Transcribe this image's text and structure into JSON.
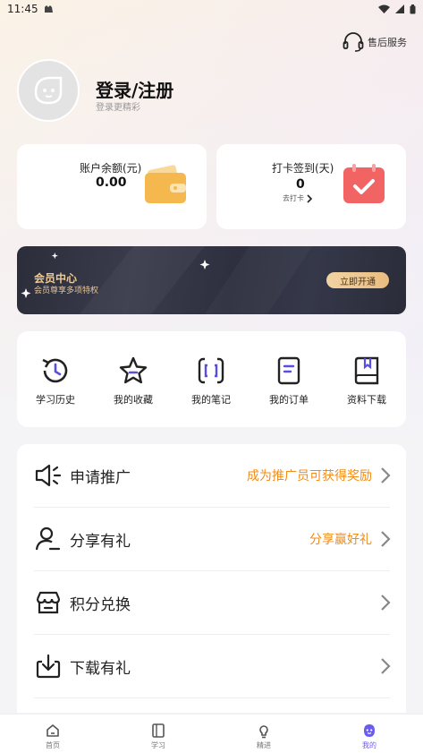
{
  "status_bar": {
    "time": "11:45"
  },
  "header": {
    "service_label": "售后服务"
  },
  "profile": {
    "title": "登录/注册",
    "subtitle": "登录更精彩"
  },
  "stats": {
    "balance": {
      "label": "账户余额(元)",
      "value": "0.00"
    },
    "checkin": {
      "label": "打卡签到(天)",
      "value": "0",
      "link": "去打卡"
    }
  },
  "member": {
    "title": "会员中心",
    "subtitle": "会员尊享多项特权",
    "button": "立即开通"
  },
  "quick_actions": [
    {
      "label": "学习历史",
      "icon": "history-icon"
    },
    {
      "label": "我的收藏",
      "icon": "star-icon"
    },
    {
      "label": "我的笔记",
      "icon": "note-icon"
    },
    {
      "label": "我的订单",
      "icon": "order-icon"
    },
    {
      "label": "资料下载",
      "icon": "book-icon"
    }
  ],
  "menu": [
    {
      "label": "申请推广",
      "hint": "成为推广员可获得奖励",
      "icon": "megaphone-icon"
    },
    {
      "label": "分享有礼",
      "hint": "分享赢好礼",
      "icon": "user-share-icon"
    },
    {
      "label": "积分兑换",
      "hint": "",
      "icon": "shop-icon"
    },
    {
      "label": "下载有礼",
      "hint": "",
      "icon": "download-icon"
    }
  ],
  "bottom_nav": [
    {
      "label": "首页",
      "icon": "home-icon",
      "active": false
    },
    {
      "label": "学习",
      "icon": "study-icon",
      "active": false
    },
    {
      "label": "精进",
      "icon": "bulb-icon",
      "active": false
    },
    {
      "label": "我的",
      "icon": "profile-icon",
      "active": true
    }
  ],
  "colors": {
    "accent": "#f08c17",
    "nav_active": "#6b5cf0",
    "banner_gold": "#f2c98c"
  }
}
